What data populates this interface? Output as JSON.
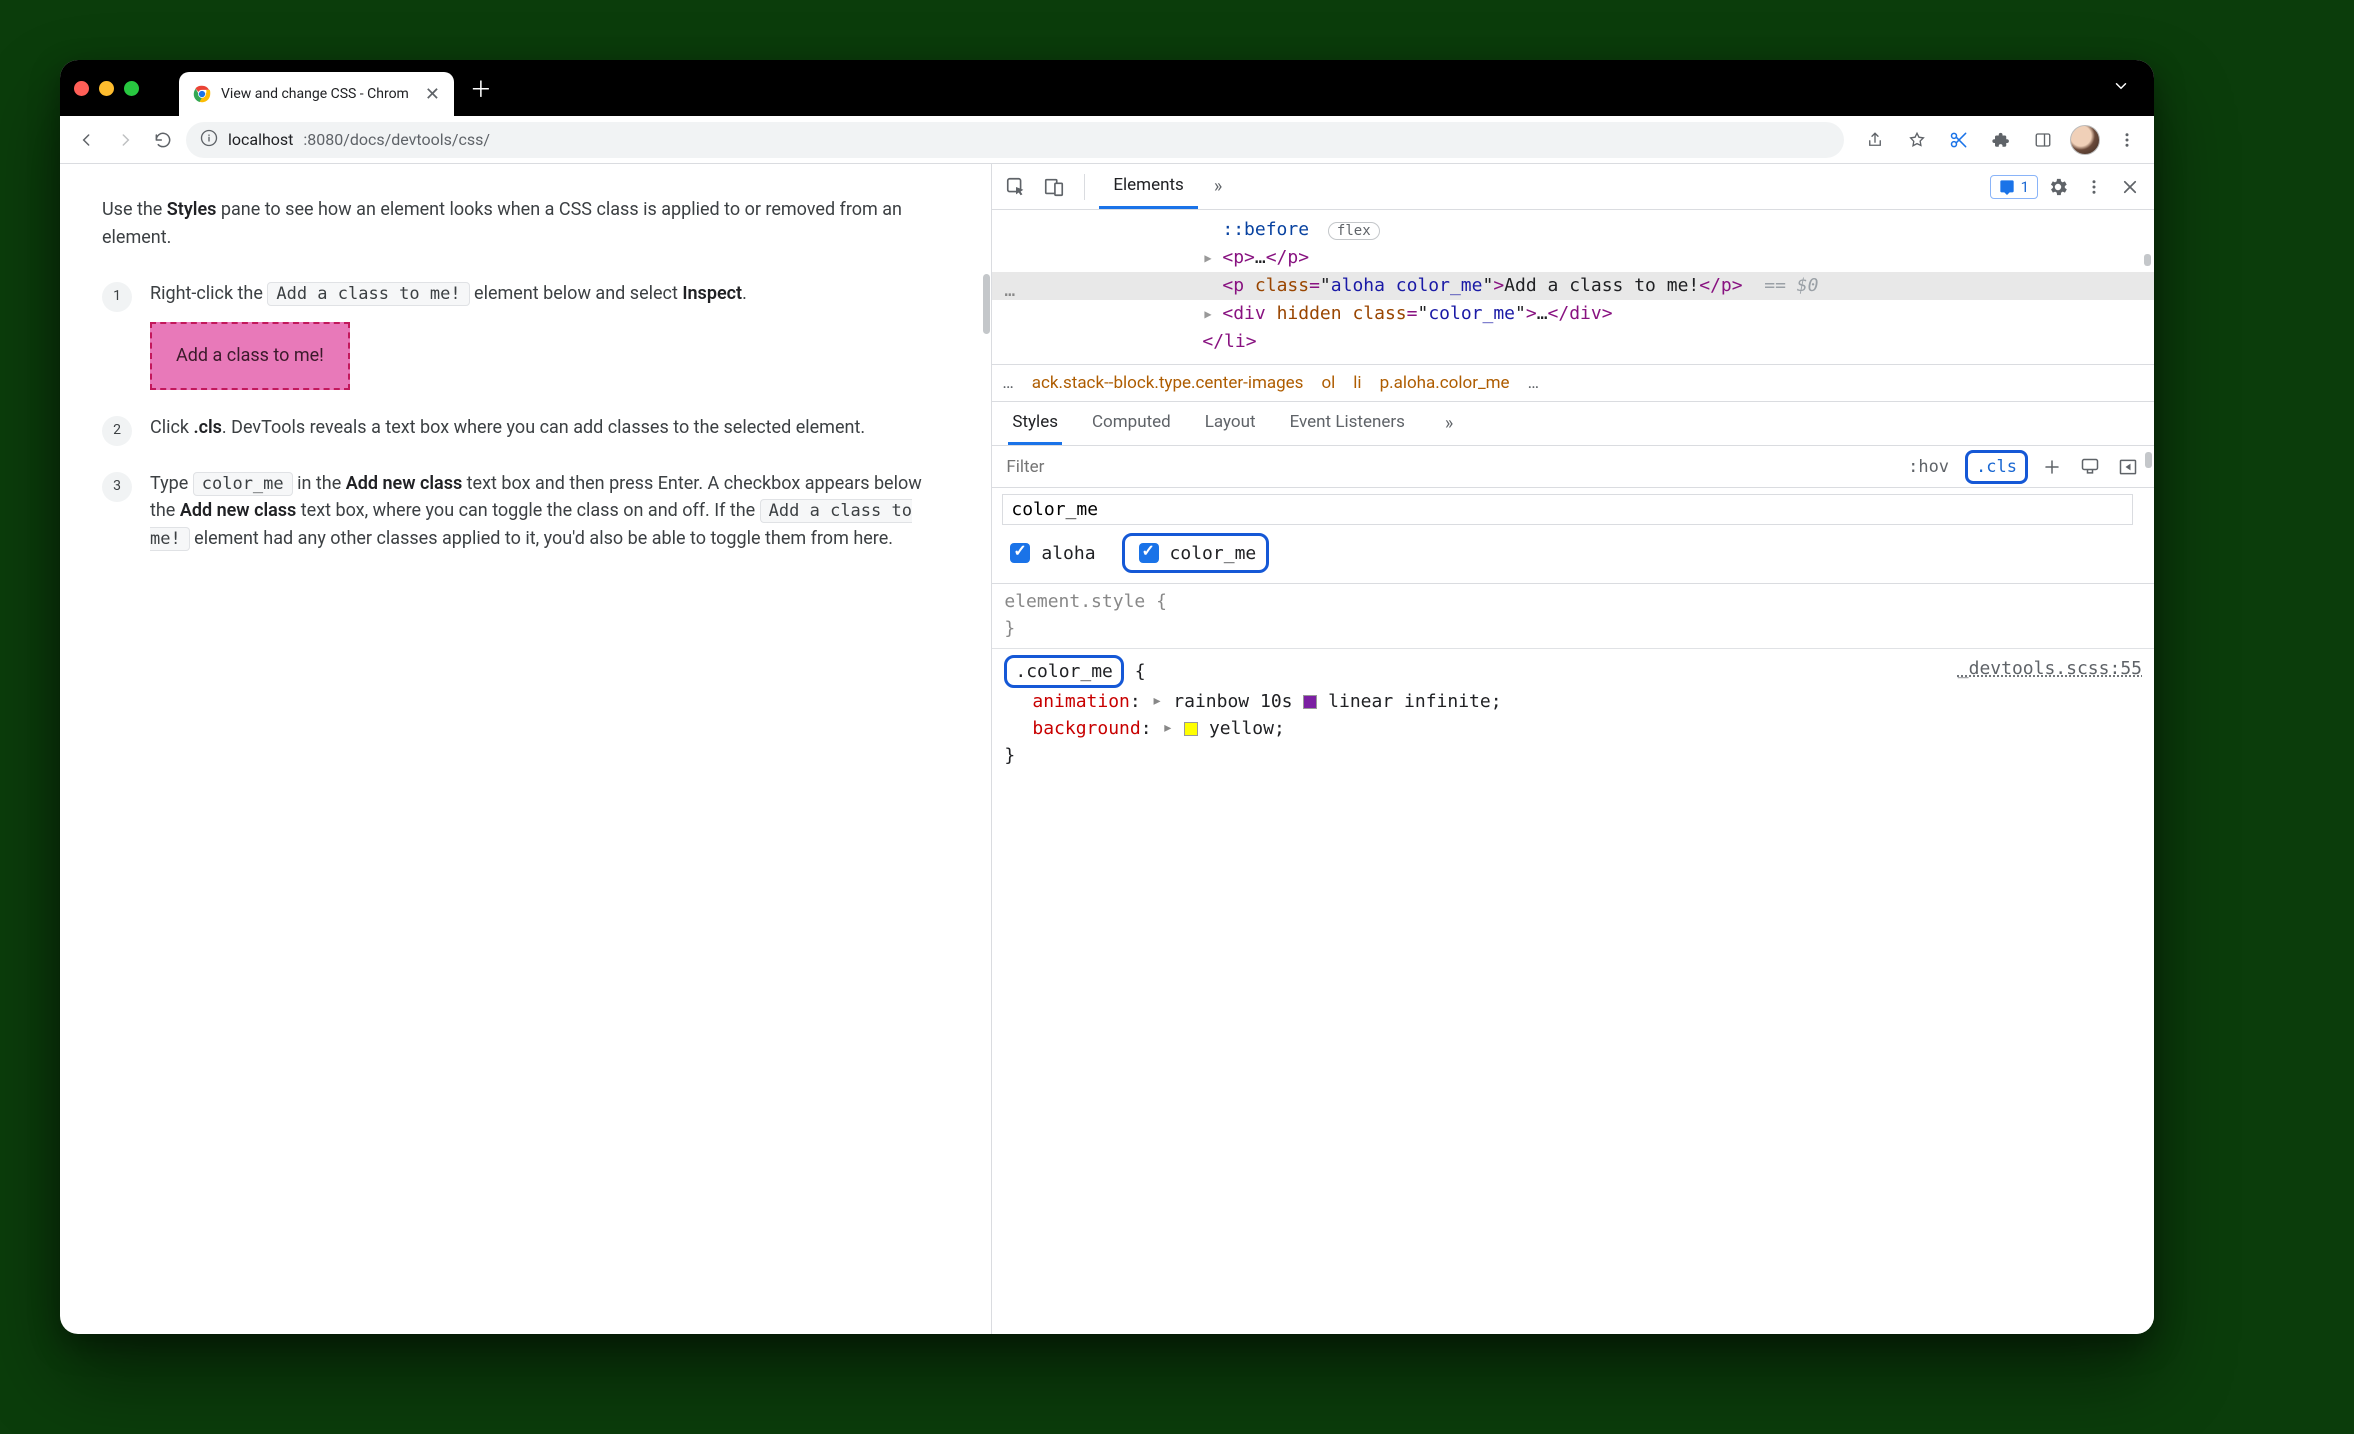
{
  "browser": {
    "tab_title": "View and change CSS - Chrom",
    "url_display": {
      "host": "localhost",
      "port_path": ":8080/docs/devtools/css/"
    }
  },
  "page": {
    "intro_prefix": "Use the ",
    "intro_bold": "Styles",
    "intro_suffix": " pane to see how an element looks when a CSS class is applied to or removed from an element.",
    "steps": {
      "1": {
        "num": "1",
        "a": "Right-click the ",
        "code": "Add a class to me!",
        "b": " element below and select ",
        "bold": "Inspect",
        "c": ".",
        "sample": "Add a class to me!"
      },
      "2": {
        "num": "2",
        "a": "Click ",
        "bold": ".cls",
        "b": ". DevTools reveals a text box where you can add classes to the selected element."
      },
      "3": {
        "num": "3",
        "a": "Type ",
        "code1": "color_me",
        "b": " in the ",
        "bold1": "Add new class",
        "c": " text box and then press Enter. A checkbox appears below the ",
        "bold2": "Add new class",
        "d": " text box, where you can toggle the class on and off. If the ",
        "code2": "Add a class to me!",
        "e": " element had any other classes applied to it, you'd also be able to toggle them from here."
      }
    }
  },
  "devtools": {
    "tabs": {
      "elements": "Elements"
    },
    "issues_count": "1",
    "elements_tree": {
      "before": "::before",
      "flex_badge": "flex",
      "p_collapsed_open": "<p>",
      "p_collapsed_ell": "…",
      "p_collapsed_close": "</p>",
      "sel_open_tag": "p",
      "sel_attr_name": "class",
      "sel_attr_val": "aloha color_me",
      "sel_text": "Add a class to me!",
      "sel_close": "</p>",
      "eq0": "== $0",
      "div_tag": "div",
      "div_hidden": "hidden",
      "div_class_name": "class",
      "div_class_val": "color_me",
      "div_ell": "…",
      "div_close": "</div>",
      "li_close": "</li>"
    },
    "crumbs": {
      "c0": "…",
      "c1": "ack.stack--block.type.center-images",
      "c2": "ol",
      "c3": "li",
      "c4": "p.aloha.color_me",
      "c5": "…"
    },
    "styles_tabs": {
      "styles": "Styles",
      "computed": "Computed",
      "layout": "Layout",
      "event": "Event Listeners"
    },
    "filter": {
      "placeholder": "Filter",
      "hov": ":hov",
      "cls": ".cls"
    },
    "cls_panel": {
      "input_value": "color_me",
      "chk1": "aloha",
      "chk2": "color_me"
    },
    "rules": {
      "element_style": "element.style {",
      "close": "}",
      "sel": ".color_me",
      "brace": " {",
      "source": "_devtools.scss:55",
      "p1_name": "animation",
      "p1_value_a": "rainbow 10s ",
      "p1_value_b": "linear infinite",
      "p2_name": "background",
      "p2_value": "yellow"
    }
  }
}
